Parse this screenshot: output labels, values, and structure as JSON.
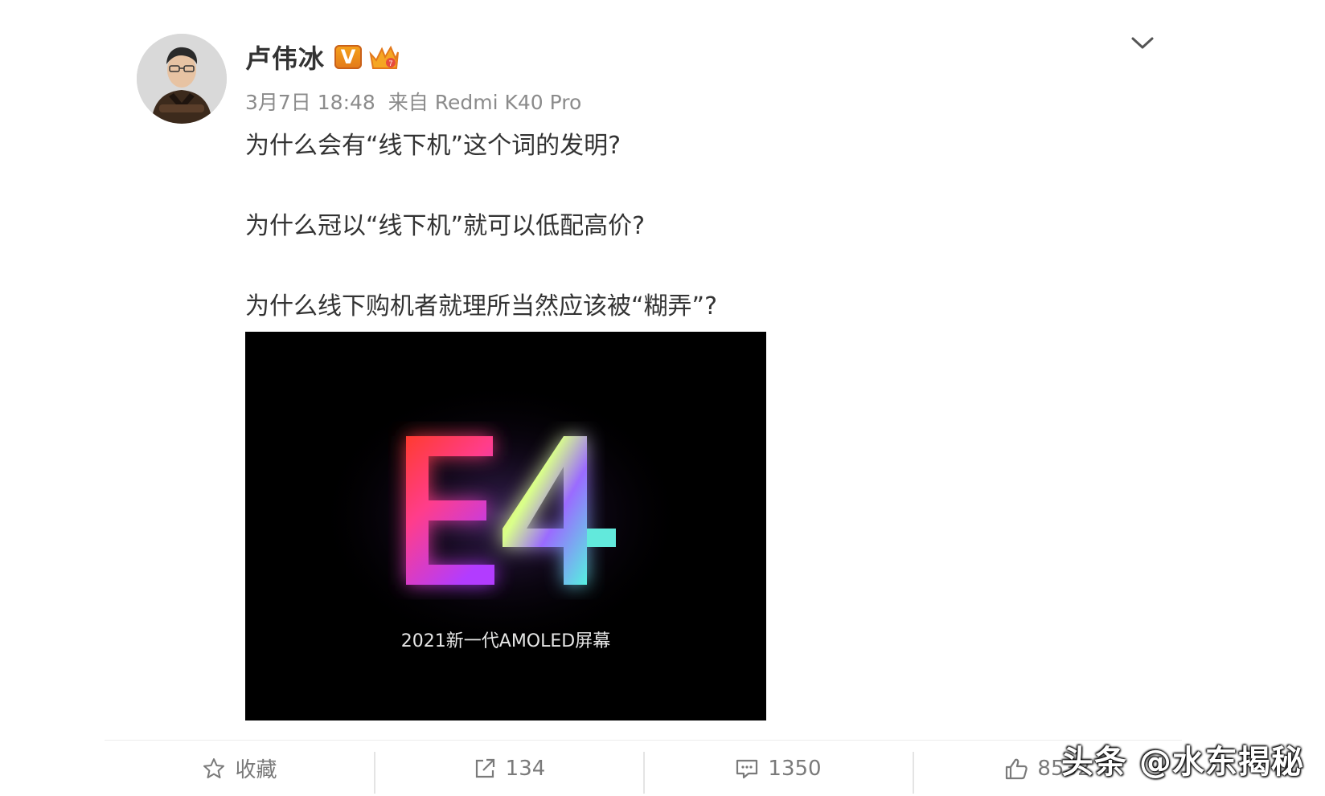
{
  "author": {
    "name": "卢伟冰",
    "verified_badge": "V"
  },
  "meta": {
    "date": "3月7日 18:48",
    "source": "来自 Redmi K40 Pro"
  },
  "post": {
    "lines": [
      "为什么会有“线下机”这个词的发明?",
      "为什么冠以“线下机”就可以低配高价?",
      "为什么线下购机者就理所当然应该被“糊弄”?"
    ],
    "image": {
      "headline": "E4",
      "caption": "2021新一代AMOLED屏幕"
    }
  },
  "actions": {
    "favorite": {
      "label": "收藏",
      "icon": "star-icon"
    },
    "repost": {
      "count": "134",
      "icon": "share-icon"
    },
    "comment": {
      "count": "1350",
      "icon": "comment-icon"
    },
    "like": {
      "count": "8532",
      "icon": "thumbs-up-icon"
    }
  },
  "watermark": "头条 @水东揭秘",
  "colors": {
    "badge_orange": "#f29a1f",
    "meta_gray": "#8b8b8b",
    "text": "#333333"
  }
}
